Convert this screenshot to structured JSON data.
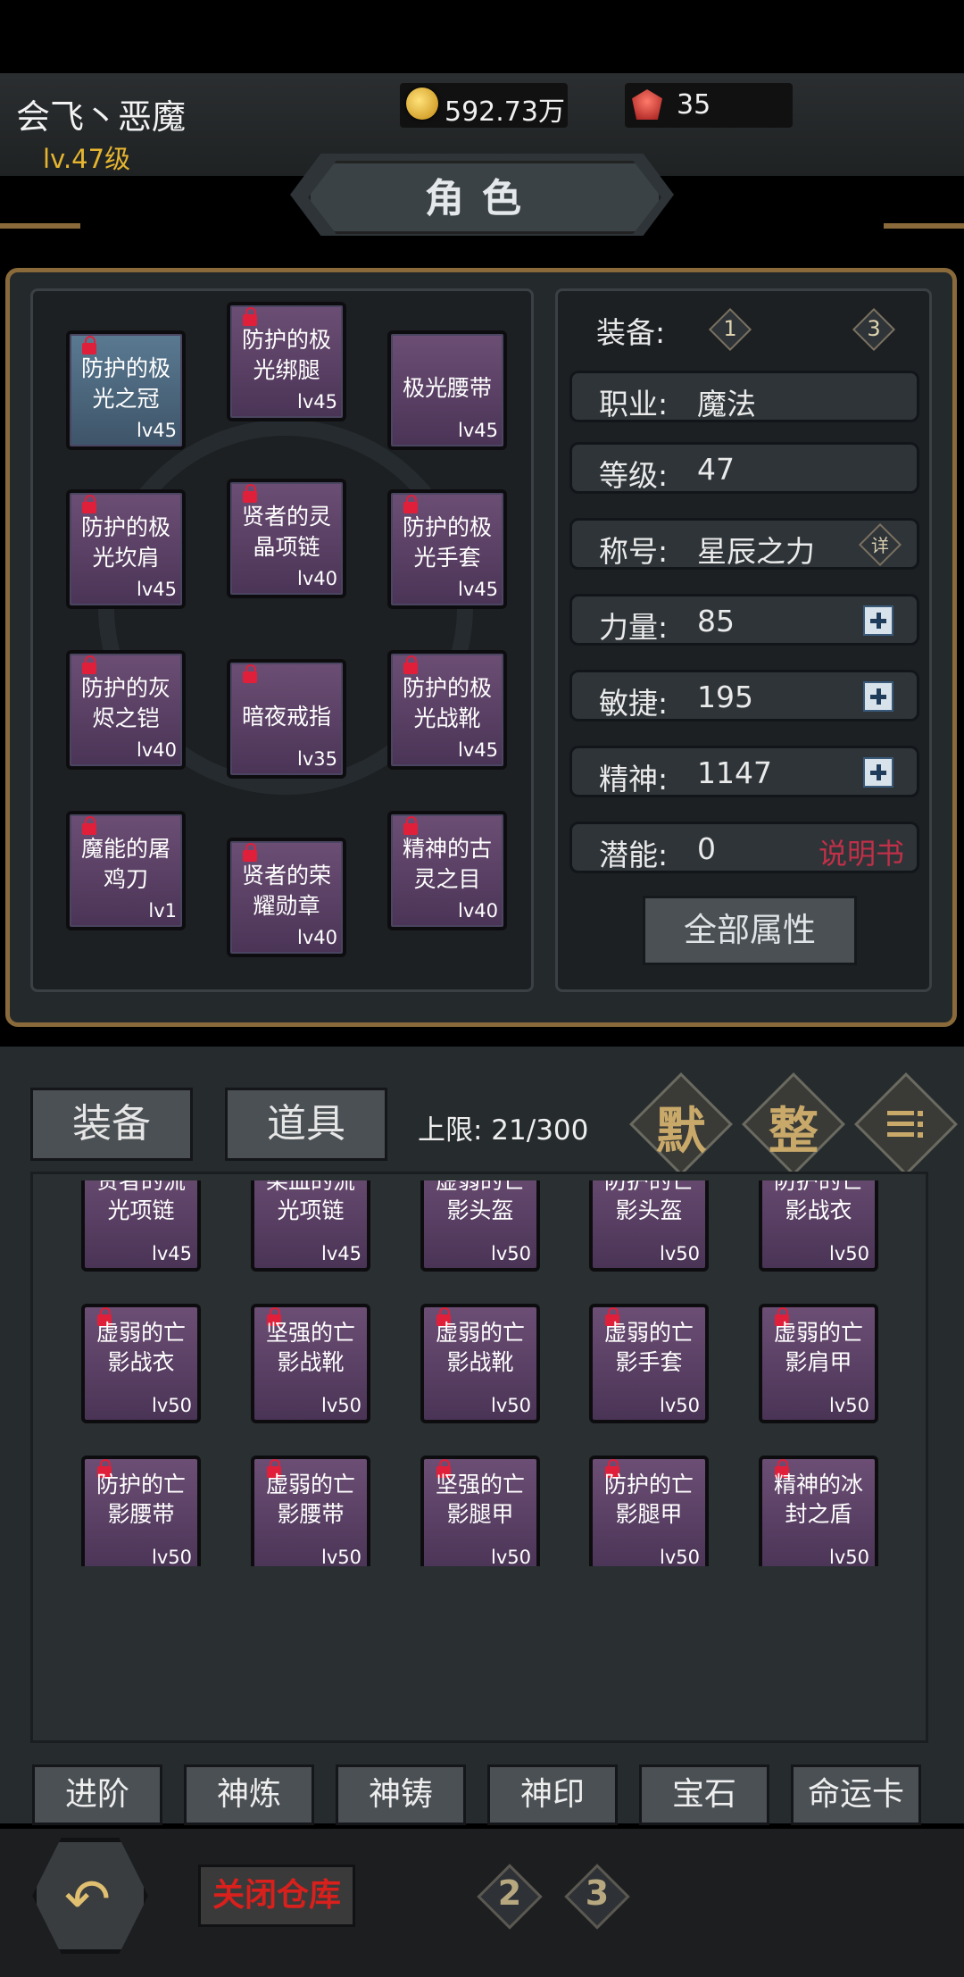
{
  "player": {
    "name": "会飞丶恶魔",
    "level": "lv.47级"
  },
  "resources": {
    "gold": "592.73万",
    "gems": "35"
  },
  "title": "角色",
  "equipped": [
    {
      "name": "防护的极\n光之冠",
      "level": "lv45",
      "locked": true
    },
    {
      "name": "防护的极\n光绑腿",
      "level": "lv45",
      "locked": true
    },
    {
      "name": "极光腰带",
      "level": "lv45",
      "locked": false
    },
    {
      "name": "防护的极\n光坎肩",
      "level": "lv45",
      "locked": true
    },
    {
      "name": "贤者的灵\n晶项链",
      "level": "lv40",
      "locked": true
    },
    {
      "name": "防护的极\n光手套",
      "level": "lv45",
      "locked": true
    },
    {
      "name": "防护的灰\n烬之铠",
      "level": "lv40",
      "locked": true
    },
    {
      "name": "暗夜戒指",
      "level": "lv35",
      "locked": true
    },
    {
      "name": "防护的极\n光战靴",
      "level": "lv45",
      "locked": true
    },
    {
      "name": "魔能的屠\n鸡刀",
      "level": "lv1",
      "locked": true
    },
    {
      "name": "贤者的荣\n耀勋章",
      "level": "lv40",
      "locked": true
    },
    {
      "name": "精神的古\n灵之目",
      "level": "lv40",
      "locked": true
    }
  ],
  "stats": {
    "equip_label": "装备:",
    "equip_set_1": "1",
    "equip_set_3": "3",
    "class_label": "职业:",
    "class_value": "魔法",
    "level_label": "等级:",
    "level_value": "47",
    "title_label": "称号:",
    "title_value": "星辰之力",
    "title_detail": "详",
    "str_label": "力量:",
    "str_value": "85",
    "agi_label": "敏捷:",
    "agi_value": "195",
    "spi_label": "精神:",
    "spi_value": "1147",
    "pot_label": "潜能:",
    "pot_value": "0",
    "manual": "说明书",
    "all_attributes": "全部属性"
  },
  "tabs": {
    "equipment": "装备",
    "items": "道具"
  },
  "capacity": "上限: 21/300",
  "sort_buttons": {
    "default": "默",
    "arrange": "整",
    "menu_icon": "list-icon"
  },
  "inventory": [
    {
      "name": "贤者的流\n光项链",
      "level": "lv45"
    },
    {
      "name": "染血的流\n光项链",
      "level": "lv45"
    },
    {
      "name": "虚弱的亡\n影头盔",
      "level": "lv50"
    },
    {
      "name": "防护的亡\n影头盔",
      "level": "lv50"
    },
    {
      "name": "防护的亡\n影战衣",
      "level": "lv50"
    },
    {
      "name": "虚弱的亡\n影战衣",
      "level": "lv50"
    },
    {
      "name": "坚强的亡\n影战靴",
      "level": "lv50"
    },
    {
      "name": "虚弱的亡\n影战靴",
      "level": "lv50"
    },
    {
      "name": "虚弱的亡\n影手套",
      "level": "lv50"
    },
    {
      "name": "虚弱的亡\n影肩甲",
      "level": "lv50"
    },
    {
      "name": "防护的亡\n影腰带",
      "level": "lv50"
    },
    {
      "name": "虚弱的亡\n影腰带",
      "level": "lv50"
    },
    {
      "name": "坚强的亡\n影腿甲",
      "level": "lv50"
    },
    {
      "name": "防护的亡\n影腿甲",
      "level": "lv50"
    },
    {
      "name": "精神的冰\n封之盾",
      "level": "lv50"
    }
  ],
  "functions": [
    "进阶",
    "神炼",
    "神铸",
    "神印",
    "宝石",
    "命运卡"
  ],
  "footer": {
    "close_warehouse": "关闭仓库",
    "page2": "2",
    "page3": "3"
  }
}
